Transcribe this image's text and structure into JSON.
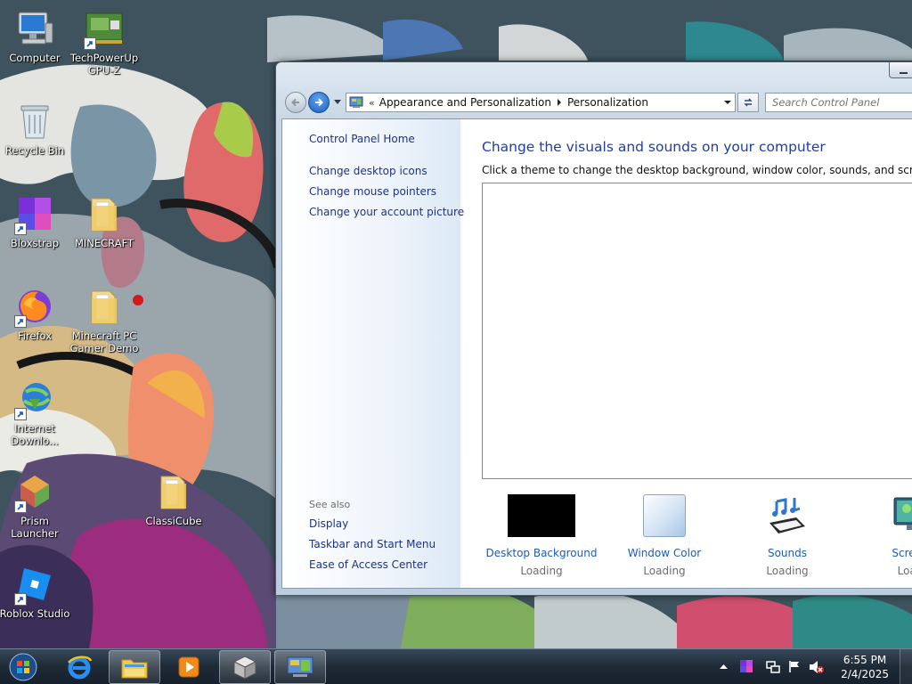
{
  "desktop": {
    "icons": [
      {
        "label": "Computer",
        "icon": "computer-icon"
      },
      {
        "label": "TechPowerUp\nGPU-Z",
        "icon": "gpuz-icon"
      },
      {
        "label": "Recycle Bin",
        "icon": "recycle-bin-icon"
      },
      {
        "label": "Bloxstrap",
        "icon": "bloxstrap-icon"
      },
      {
        "label": "MINECRAFT",
        "icon": "folder-icon"
      },
      {
        "label": "Firefox",
        "icon": "firefox-icon"
      },
      {
        "label": "Minecraft PC\nGamer Demo",
        "icon": "folder-icon"
      },
      {
        "label": "Internet\nDownlo...",
        "icon": "internet-download-manager-icon"
      },
      {
        "label": "Prism\nLauncher",
        "icon": "prism-launcher-icon"
      },
      {
        "label": "ClassiCube",
        "icon": "folder-icon"
      },
      {
        "label": "Roblox Studio",
        "icon": "roblox-studio-icon"
      }
    ]
  },
  "window": {
    "address": {
      "overflow": "«",
      "crumbs": [
        "Appearance and Personalization",
        "Personalization"
      ]
    },
    "search_placeholder": "Search Control Panel",
    "left_pane": {
      "home": "Control Panel Home",
      "links": [
        "Change desktop icons",
        "Change mouse pointers",
        "Change your account picture"
      ],
      "see_also_label": "See also",
      "see_also": [
        "Display",
        "Taskbar and Start Menu",
        "Ease of Access Center"
      ]
    },
    "main": {
      "title": "Change the visuals and sounds on your computer",
      "subtitle": "Click a theme to change the desktop background, window color, sounds, and screen saver a",
      "tiles": [
        {
          "name": "Desktop Background",
          "status": "Loading"
        },
        {
          "name": "Window Color",
          "status": "Loading"
        },
        {
          "name": "Sounds",
          "status": "Loading"
        },
        {
          "name": "Screen",
          "status": "Load"
        }
      ]
    }
  },
  "taskbar": {
    "items": [
      "start-orb-icon",
      "internet-explorer-icon",
      "file-explorer-icon",
      "media-player-icon",
      "classicube-icon",
      "control-panel-icon"
    ],
    "clock": {
      "time": "6:55 PM",
      "date": "2/4/2025"
    }
  },
  "colors": {
    "link_blue": "#1e3287",
    "title_blue": "#1e3fa1",
    "taskbar": "#1e2a36"
  }
}
